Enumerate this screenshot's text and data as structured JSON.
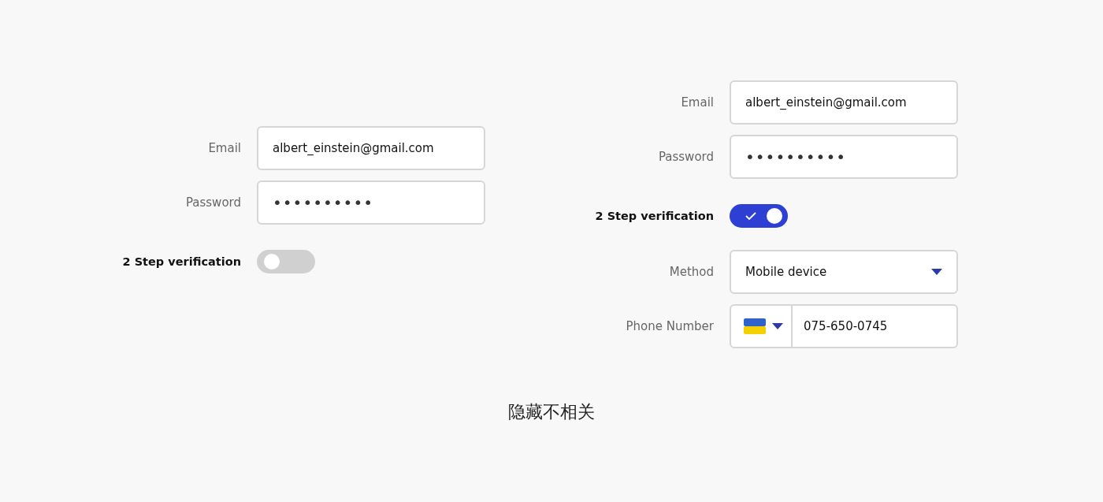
{
  "forms": [
    {
      "fields": [
        {
          "kind": "text",
          "label": "Email",
          "value": "albert_einstein@gmail.com"
        },
        {
          "kind": "password",
          "label": "Password",
          "value": "••••••••••"
        },
        {
          "kind": "toggle",
          "label": "2 Step verification",
          "on": false
        }
      ]
    },
    {
      "fields": [
        {
          "kind": "text",
          "label": "Email",
          "value": "albert_einstein@gmail.com"
        },
        {
          "kind": "password",
          "label": "Password",
          "value": "••••••••••"
        },
        {
          "kind": "toggle",
          "label": "2 Step verification",
          "on": true
        },
        {
          "kind": "select",
          "label": "Method",
          "value": "Mobile device"
        },
        {
          "kind": "phone",
          "label": "Phone Number",
          "value": "075-650-0745"
        }
      ]
    }
  ],
  "caption": "隐藏不相关"
}
